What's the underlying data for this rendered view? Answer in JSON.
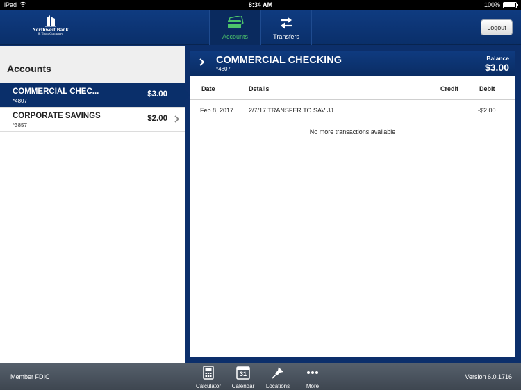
{
  "status_bar": {
    "device": "iPad",
    "time": "8:34 AM",
    "battery": "100%"
  },
  "header": {
    "logo": {
      "name": "Northwest Bank",
      "subtitle": "& Trust Company"
    },
    "tabs": [
      {
        "label": "Accounts",
        "icon": "credit-cards-icon",
        "active": true
      },
      {
        "label": "Transfers",
        "icon": "swap-arrows-icon",
        "active": false
      }
    ],
    "logout_label": "Logout"
  },
  "accounts_panel": {
    "title": "Accounts",
    "items": [
      {
        "name": "COMMERCIAL CHEC...",
        "number": "*4807",
        "balance": "$3.00",
        "selected": true
      },
      {
        "name": "CORPORATE SAVINGS",
        "number": "*3857",
        "balance": "$2.00",
        "selected": false
      }
    ]
  },
  "detail": {
    "account_name": "COMMERCIAL CHECKING",
    "account_number": "*4807",
    "balance_label": "Balance",
    "balance": "$3.00",
    "columns": {
      "date": "Date",
      "details": "Details",
      "credit": "Credit",
      "debit": "Debit"
    },
    "transactions": [
      {
        "date": "Feb 8, 2017",
        "details": "2/7/17 TRANSFER TO SAV JJ",
        "credit": "",
        "debit": "-$2.00"
      }
    ],
    "empty_message": "No more transactions available"
  },
  "footer": {
    "left_text": "Member FDIC",
    "version": "Version 6.0.1716",
    "tools": [
      {
        "label": "Calculator",
        "icon": "calculator-icon"
      },
      {
        "label": "Calendar",
        "icon": "calendar-icon",
        "day": "31"
      },
      {
        "label": "Locations",
        "icon": "location-pin-icon"
      },
      {
        "label": "More",
        "icon": "more-dots-icon"
      }
    ]
  },
  "colors": {
    "brand_blue": "#0a2f6a",
    "active_green": "#4cc36b"
  }
}
